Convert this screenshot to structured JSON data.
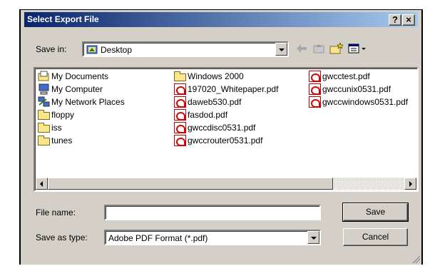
{
  "dialog": {
    "title": "Select Export File",
    "help_label": "?",
    "close_label": "×"
  },
  "save_in": {
    "label": "Save in:",
    "value": "Desktop"
  },
  "files": {
    "col1": [
      {
        "name": "My Documents",
        "icon": "my-documents-icon"
      },
      {
        "name": "My Computer",
        "icon": "my-computer-icon"
      },
      {
        "name": "My Network Places",
        "icon": "network-places-icon"
      },
      {
        "name": "floppy",
        "icon": "folder-icon"
      },
      {
        "name": "iss",
        "icon": "folder-icon"
      },
      {
        "name": "tunes",
        "icon": "folder-icon"
      }
    ],
    "col2": [
      {
        "name": "Windows 2000",
        "icon": "folder-icon"
      },
      {
        "name": "197020_Whitepaper.pdf",
        "icon": "pdf-icon"
      },
      {
        "name": "daweb530.pdf",
        "icon": "pdf-icon"
      },
      {
        "name": "fasdod.pdf",
        "icon": "pdf-icon"
      },
      {
        "name": "gwccdisc0531.pdf",
        "icon": "pdf-icon"
      },
      {
        "name": "gwccrouter0531.pdf",
        "icon": "pdf-icon"
      }
    ],
    "col3": [
      {
        "name": "gwcctest.pdf",
        "icon": "pdf-icon"
      },
      {
        "name": "gwccunix0531.pdf",
        "icon": "pdf-icon"
      },
      {
        "name": "gwccwindows0531.pdf",
        "icon": "pdf-icon"
      }
    ]
  },
  "file_name": {
    "label": "File name:",
    "value": ""
  },
  "save_as_type": {
    "label": "Save as type:",
    "value": "Adobe PDF Format (*.pdf)"
  },
  "buttons": {
    "save": "Save",
    "cancel": "Cancel"
  },
  "colors": {
    "title_gradient_start": "#0a246a",
    "title_gradient_end": "#a6caf0",
    "face": "#d4d0c8"
  }
}
